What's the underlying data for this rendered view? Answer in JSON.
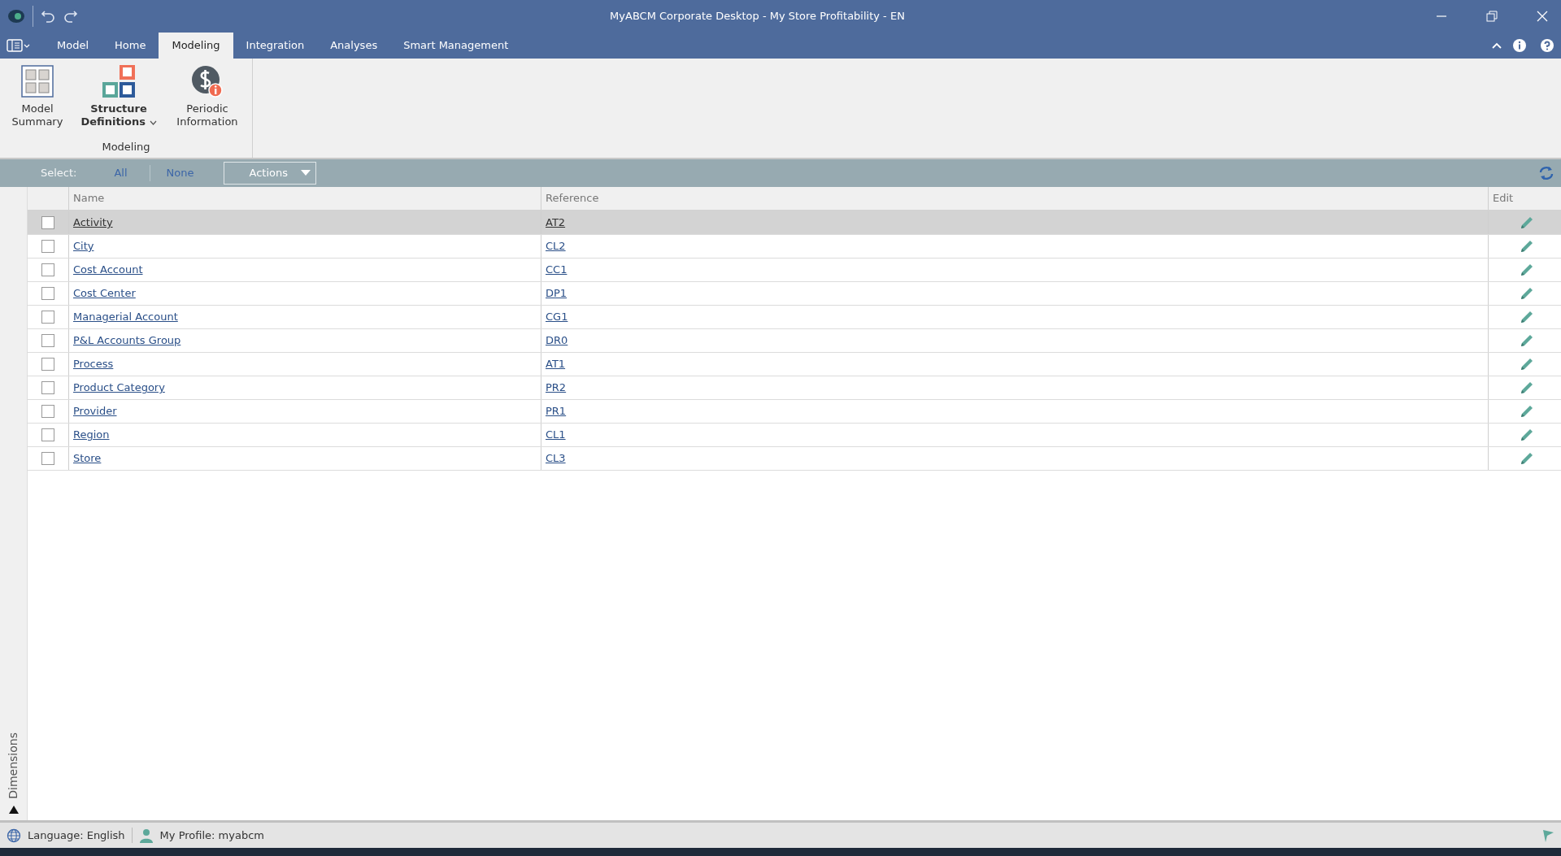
{
  "window": {
    "title": "MyABCM Corporate Desktop - My Store Profitability - EN"
  },
  "tabs": [
    {
      "label": "Model",
      "selected": false
    },
    {
      "label": "Home",
      "selected": false
    },
    {
      "label": "Modeling",
      "selected": true
    },
    {
      "label": "Integration",
      "selected": false
    },
    {
      "label": "Analyses",
      "selected": false
    },
    {
      "label": "Smart Management",
      "selected": false
    }
  ],
  "ribbon": {
    "group_label": "Modeling",
    "buttons": [
      {
        "label": "Model Summary",
        "kind": "summary",
        "selected": false
      },
      {
        "label": "Structure Definitions",
        "kind": "structure",
        "selected": true
      },
      {
        "label": "Periodic Information",
        "kind": "periodic",
        "selected": false
      }
    ]
  },
  "toolbar": {
    "select_label": "Select:",
    "links": [
      "All",
      "None"
    ],
    "actions": "Actions"
  },
  "table": {
    "columns": [
      "Name",
      "Reference",
      "Edit"
    ],
    "rows": [
      {
        "name": "Activity",
        "reference": "AT2",
        "checked": false,
        "selected": true
      },
      {
        "name": "City",
        "reference": "CL2",
        "checked": false,
        "selected": false
      },
      {
        "name": "Cost Account",
        "reference": "CC1",
        "checked": false,
        "selected": false
      },
      {
        "name": "Cost Center",
        "reference": "DP1",
        "checked": false,
        "selected": false
      },
      {
        "name": "Managerial Account",
        "reference": "CG1",
        "checked": false,
        "selected": false
      },
      {
        "name": "P&L Accounts Group",
        "reference": "DR0",
        "checked": false,
        "selected": false
      },
      {
        "name": "Process",
        "reference": "AT1",
        "checked": false,
        "selected": false
      },
      {
        "name": "Product Category",
        "reference": "PR2",
        "checked": false,
        "selected": false
      },
      {
        "name": "Provider",
        "reference": "PR1",
        "checked": false,
        "selected": false
      },
      {
        "name": "Region",
        "reference": "CL1",
        "checked": false,
        "selected": false
      },
      {
        "name": "Store",
        "reference": "CL3",
        "checked": false,
        "selected": false
      }
    ]
  },
  "side_panel": {
    "label": "Dimensions"
  },
  "status_bar": {
    "language": "Language: English",
    "profile": "My Profile: myabcm"
  }
}
